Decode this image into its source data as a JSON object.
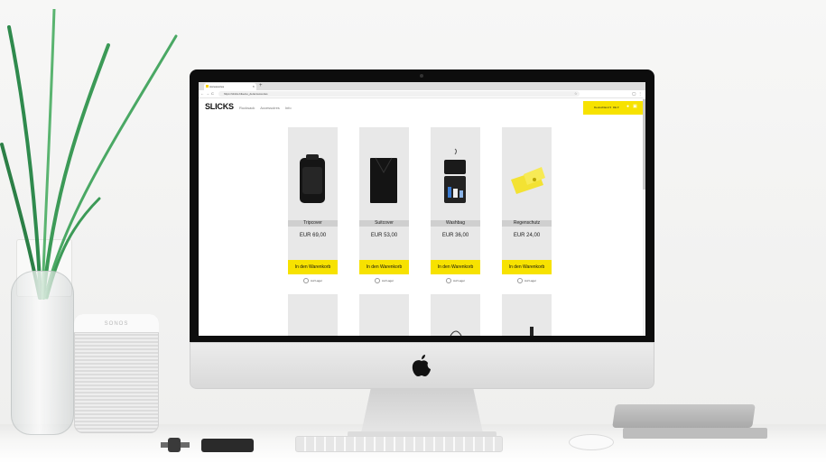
{
  "browser": {
    "tab_title": "Accessories",
    "tab_close": "×",
    "new_tab": "+",
    "url": "https://slicks.bike/eu_de/accessories",
    "back": "←",
    "forward": "→",
    "reload": "C",
    "lock": "🔒",
    "star": "☆",
    "profile": "◯",
    "menu": "⋮"
  },
  "site": {
    "logo": "SLICKS",
    "nav": [
      "Rucksack",
      "Accessoires",
      "Info"
    ],
    "currency": "Deutschland ▾",
    "language": "DE ▾",
    "user_icon": "user-icon",
    "cart_icon": "cart-icon"
  },
  "products": [
    {
      "name": "Tripcover",
      "price": "EUR 69,00",
      "button": "In den Warenkorb",
      "stock": "Auf Lager",
      "image": "tripcover-image"
    },
    {
      "name": "Suitcover",
      "price": "EUR 53,00",
      "button": "In den Warenkorb",
      "stock": "Auf Lager",
      "image": "suitcover-image"
    },
    {
      "name": "Washbag",
      "price": "EUR 36,00",
      "button": "In den Warenkorb",
      "stock": "Auf Lager",
      "image": "washbag-image"
    },
    {
      "name": "Regenschutz",
      "price": "EUR 24,00",
      "button": "In den Warenkorb",
      "stock": "Auf Lager",
      "image": "regenschutz-image"
    }
  ],
  "scene": {
    "speaker_brand": "SONOS"
  },
  "colors": {
    "accent": "#f7e200",
    "card_bg": "#e8e8e8",
    "name_bar": "#cfcfcf"
  }
}
